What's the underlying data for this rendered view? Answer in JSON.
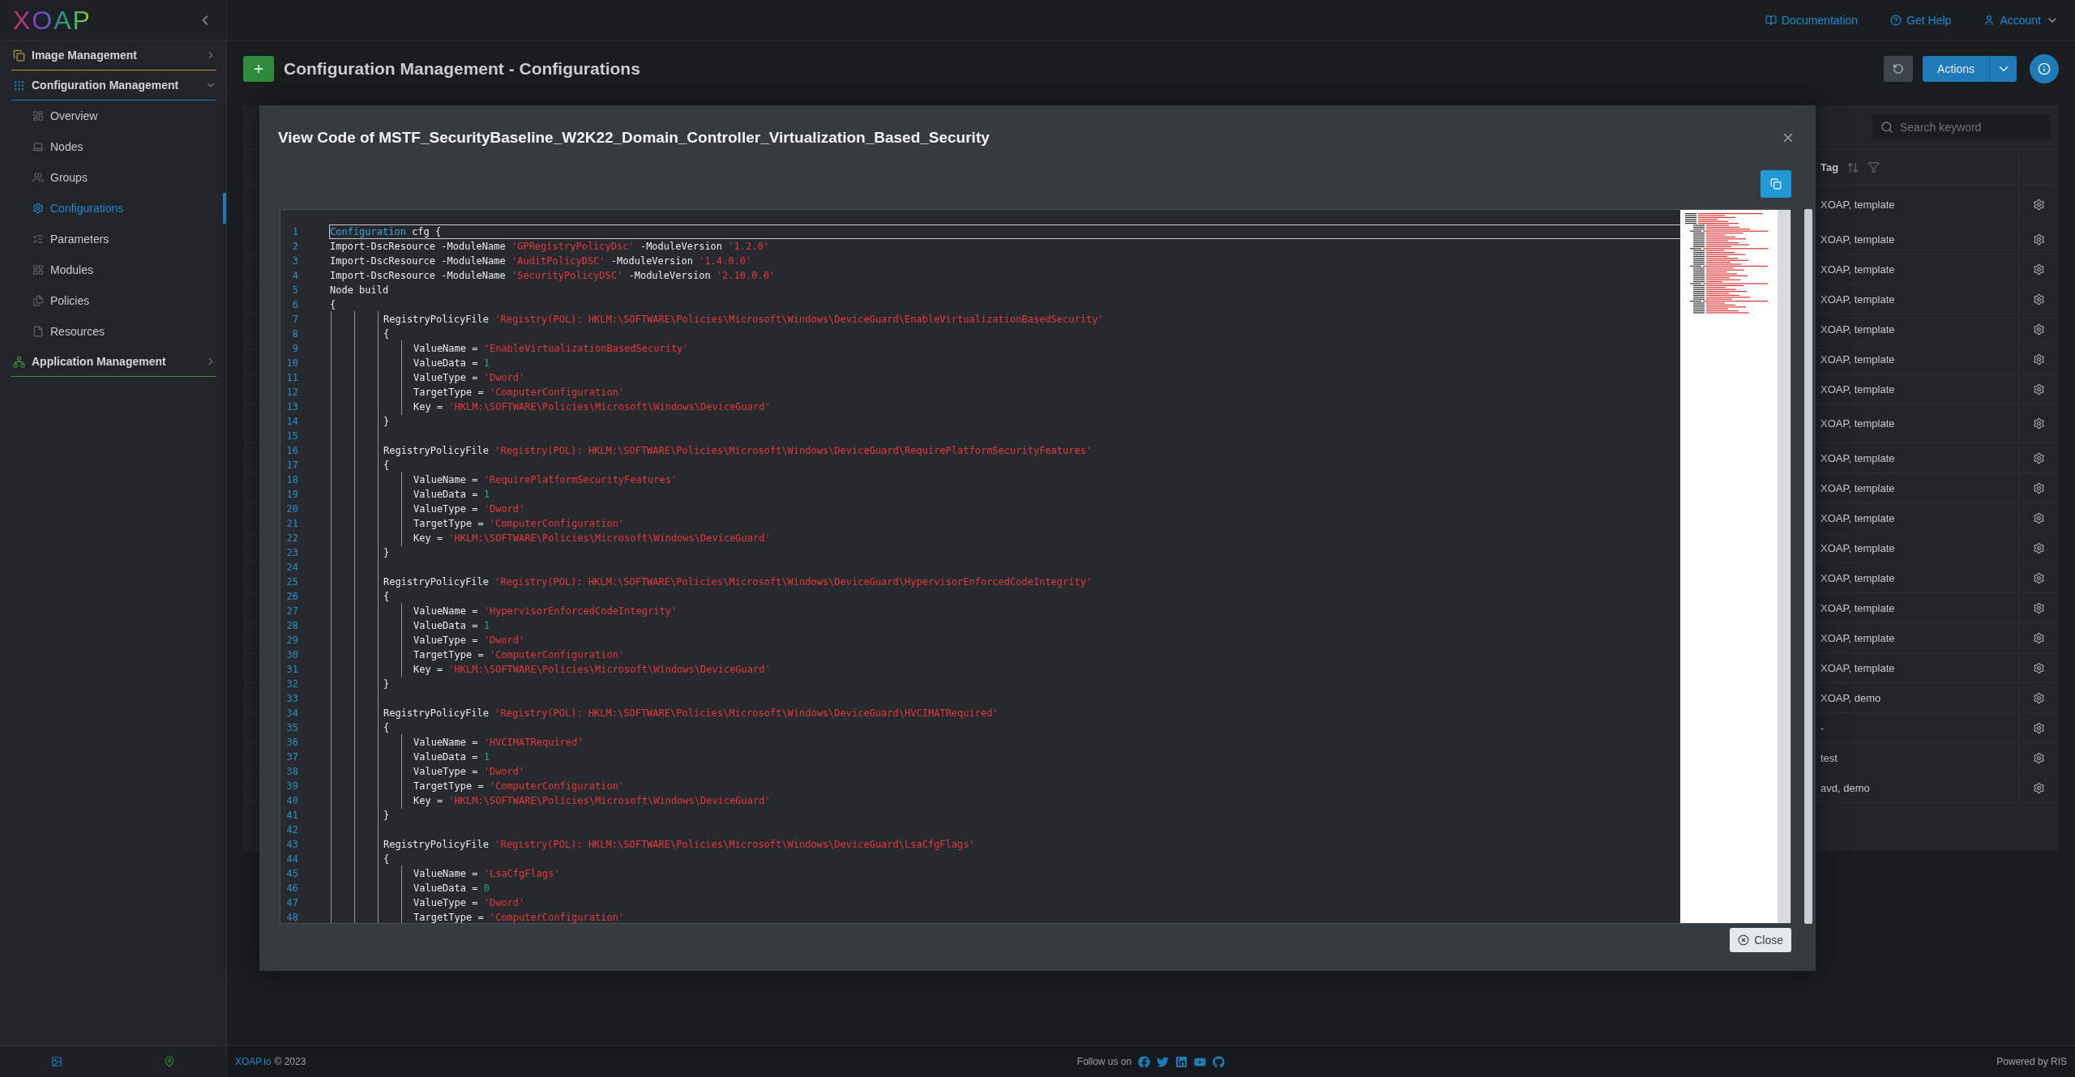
{
  "sidebar": {
    "logo": "XOAP",
    "groups": [
      {
        "label": "Image Management",
        "expanded": false,
        "color": "#b8962e"
      },
      {
        "label": "Configuration Management",
        "expanded": true,
        "color": "#1f7ab8",
        "items": [
          {
            "label": "Overview",
            "selected": false
          },
          {
            "label": "Nodes",
            "selected": false
          },
          {
            "label": "Groups",
            "selected": false
          },
          {
            "label": "Configurations",
            "selected": true
          },
          {
            "label": "Parameters",
            "selected": false
          },
          {
            "label": "Modules",
            "selected": false
          },
          {
            "label": "Policies",
            "selected": false
          },
          {
            "label": "Resources",
            "selected": false
          }
        ]
      },
      {
        "label": "Application Management",
        "expanded": false,
        "color": "#3d8f3a"
      }
    ]
  },
  "top_bar": {
    "links": [
      "Documentation",
      "Get Help",
      "Account"
    ]
  },
  "header": {
    "title": "Configuration Management - Configurations",
    "actions_label": "Actions"
  },
  "table": {
    "search": {
      "placeholder": "Search keyword"
    },
    "column": "Tag",
    "rows": [
      {
        "tag": "XOAP, template"
      },
      {
        "tag": "XOAP, template"
      },
      {
        "tag": "XOAP, template"
      },
      {
        "tag": "XOAP, template"
      },
      {
        "tag": "XOAP, template"
      },
      {
        "tag": "XOAP, template"
      },
      {
        "tag": "XOAP, template"
      },
      {
        "tag": "XOAP, template"
      },
      {
        "tag": "XOAP, template"
      },
      {
        "tag": "XOAP, template"
      },
      {
        "tag": "XOAP, template"
      },
      {
        "tag": "XOAP, template"
      },
      {
        "tag": "XOAP, template"
      },
      {
        "tag": "XOAP, template"
      },
      {
        "tag": "XOAP, template"
      },
      {
        "tag": "XOAP, template"
      },
      {
        "tag": "XOAP, demo"
      },
      {
        "tag": "-"
      },
      {
        "tag": "test"
      },
      {
        "tag": "avd, demo"
      }
    ]
  },
  "modal": {
    "title": "View Code of MSTF_SecurityBaseline_W2K22_Domain_Controller_Virtualization_Based_Security",
    "close_label": "Close",
    "lines": [
      {
        "number": "1",
        "active": true,
        "tokens": [
          {
            "kind": "keyword",
            "text": "Configuration"
          },
          {
            "kind": "plain",
            "text": " cfg {"
          }
        ]
      },
      {
        "number": "2",
        "tokens": [
          {
            "kind": "plain",
            "text": "Import-DscResource -ModuleName "
          },
          {
            "kind": "string",
            "text": "'GPRegistryPolicyDsc'"
          },
          {
            "kind": "plain",
            "text": " -ModuleVersion "
          },
          {
            "kind": "string",
            "text": "'1.2.0'"
          }
        ]
      },
      {
        "number": "3",
        "tokens": [
          {
            "kind": "plain",
            "text": "Import-DscResource -ModuleName "
          },
          {
            "kind": "string",
            "text": "'AuditPolicyDSC'"
          },
          {
            "kind": "plain",
            "text": " -ModuleVersion "
          },
          {
            "kind": "string",
            "text": "'1.4.0.0'"
          }
        ]
      },
      {
        "number": "4",
        "tokens": [
          {
            "kind": "plain",
            "text": "Import-DscResource -ModuleName "
          },
          {
            "kind": "string",
            "text": "'SecurityPolicyDSC'"
          },
          {
            "kind": "plain",
            "text": " -ModuleVersion "
          },
          {
            "kind": "string",
            "text": "'2.10.0.0'"
          }
        ]
      },
      {
        "number": "5",
        "tokens": [
          {
            "kind": "plain",
            "text": "Node build"
          }
        ]
      },
      {
        "number": "6",
        "tokens": [
          {
            "kind": "plain",
            "text": "{"
          }
        ]
      },
      {
        "number": "7",
        "tokens": [
          {
            "kind": "plain",
            "text": "            RegistryPolicyFile "
          },
          {
            "kind": "string",
            "text": "'Registry(POL): HKLM:\\SOFTWARE\\Policies\\Microsoft\\Windows\\DeviceGuard\\EnableVirtualizationBasedSecurity'"
          }
        ]
      },
      {
        "number": "8",
        "tokens": [
          {
            "kind": "plain",
            "text": "            {"
          }
        ]
      },
      {
        "number": "9",
        "tokens": [
          {
            "kind": "plain",
            "text": "                ValueName = "
          },
          {
            "kind": "string",
            "text": "'EnableVirtualizationBasedSecurity'"
          }
        ]
      },
      {
        "number": "10",
        "tokens": [
          {
            "kind": "plain",
            "text": "                ValueData = "
          },
          {
            "kind": "number",
            "text": "1"
          }
        ]
      },
      {
        "number": "11",
        "tokens": [
          {
            "kind": "plain",
            "text": "                ValueType = "
          },
          {
            "kind": "string",
            "text": "'Dword'"
          }
        ]
      },
      {
        "number": "12",
        "tokens": [
          {
            "kind": "plain",
            "text": "                TargetType = "
          },
          {
            "kind": "string",
            "text": "'ComputerConfiguration'"
          }
        ]
      },
      {
        "number": "13",
        "tokens": [
          {
            "kind": "plain",
            "text": "                Key = "
          },
          {
            "kind": "string",
            "text": "'HKLM:\\SOFTWARE\\Policies\\Microsoft\\Windows\\DeviceGuard'"
          }
        ]
      },
      {
        "number": "14",
        "tokens": [
          {
            "kind": "plain",
            "text": "            }"
          }
        ]
      },
      {
        "number": "15"
      },
      {
        "number": "16",
        "tokens": [
          {
            "kind": "plain",
            "text": "            RegistryPolicyFile "
          },
          {
            "kind": "string",
            "text": "'Registry(POL): HKLM:\\SOFTWARE\\Policies\\Microsoft\\Windows\\DeviceGuard\\RequirePlatformSecurityFeatures'"
          }
        ]
      },
      {
        "number": "17",
        "tokens": [
          {
            "kind": "plain",
            "text": "            {"
          }
        ]
      },
      {
        "number": "18",
        "tokens": [
          {
            "kind": "plain",
            "text": "                ValueName = "
          },
          {
            "kind": "string",
            "text": "'RequirePlatformSecurityFeatures'"
          }
        ]
      },
      {
        "number": "19",
        "tokens": [
          {
            "kind": "plain",
            "text": "                ValueData = "
          },
          {
            "kind": "number",
            "text": "1"
          }
        ]
      },
      {
        "number": "20",
        "tokens": [
          {
            "kind": "plain",
            "text": "                ValueType = "
          },
          {
            "kind": "string",
            "text": "'Dword'"
          }
        ]
      },
      {
        "number": "21",
        "tokens": [
          {
            "kind": "plain",
            "text": "                TargetType = "
          },
          {
            "kind": "string",
            "text": "'ComputerConfiguration'"
          }
        ]
      },
      {
        "number": "22",
        "tokens": [
          {
            "kind": "plain",
            "text": "                Key = "
          },
          {
            "kind": "string",
            "text": "'HKLM:\\SOFTWARE\\Policies\\Microsoft\\Windows\\DeviceGuard'"
          }
        ]
      },
      {
        "number": "23",
        "tokens": [
          {
            "kind": "plain",
            "text": "            }"
          }
        ]
      },
      {
        "number": "24"
      },
      {
        "number": "25",
        "tokens": [
          {
            "kind": "plain",
            "text": "            RegistryPolicyFile "
          },
          {
            "kind": "string",
            "text": "'Registry(POL): HKLM:\\SOFTWARE\\Policies\\Microsoft\\Windows\\DeviceGuard\\HypervisorEnforcedCodeIntegrity'"
          }
        ]
      },
      {
        "number": "26",
        "tokens": [
          {
            "kind": "plain",
            "text": "            {"
          }
        ]
      },
      {
        "number": "27",
        "tokens": [
          {
            "kind": "plain",
            "text": "                ValueName = "
          },
          {
            "kind": "string",
            "text": "'HypervisorEnforcedCodeIntegrity'"
          }
        ]
      },
      {
        "number": "28",
        "tokens": [
          {
            "kind": "plain",
            "text": "                ValueData = "
          },
          {
            "kind": "number",
            "text": "1"
          }
        ]
      },
      {
        "number": "29",
        "tokens": [
          {
            "kind": "plain",
            "text": "                ValueType = "
          },
          {
            "kind": "string",
            "text": "'Dword'"
          }
        ]
      },
      {
        "number": "30",
        "tokens": [
          {
            "kind": "plain",
            "text": "                TargetType = "
          },
          {
            "kind": "string",
            "text": "'ComputerConfiguration'"
          }
        ]
      },
      {
        "number": "31",
        "tokens": [
          {
            "kind": "plain",
            "text": "                Key = "
          },
          {
            "kind": "string",
            "text": "'HKLM:\\SOFTWARE\\Policies\\Microsoft\\Windows\\DeviceGuard'"
          }
        ]
      },
      {
        "number": "32",
        "tokens": [
          {
            "kind": "plain",
            "text": "            }"
          }
        ]
      },
      {
        "number": "33"
      },
      {
        "number": "34",
        "tokens": [
          {
            "kind": "plain",
            "text": "            RegistryPolicyFile "
          },
          {
            "kind": "string",
            "text": "'Registry(POL): HKLM:\\SOFTWARE\\Policies\\Microsoft\\Windows\\DeviceGuard\\HVCIMATRequired'"
          }
        ]
      },
      {
        "number": "35",
        "tokens": [
          {
            "kind": "plain",
            "text": "            {"
          }
        ]
      },
      {
        "number": "36",
        "tokens": [
          {
            "kind": "plain",
            "text": "                ValueName = "
          },
          {
            "kind": "string",
            "text": "'HVCIMATRequired'"
          }
        ]
      },
      {
        "number": "37",
        "tokens": [
          {
            "kind": "plain",
            "text": "                ValueData = "
          },
          {
            "kind": "number",
            "text": "1"
          }
        ]
      },
      {
        "number": "38",
        "tokens": [
          {
            "kind": "plain",
            "text": "                ValueType = "
          },
          {
            "kind": "string",
            "text": "'Dword'"
          }
        ]
      },
      {
        "number": "39",
        "tokens": [
          {
            "kind": "plain",
            "text": "                TargetType = "
          },
          {
            "kind": "string",
            "text": "'ComputerConfiguration'"
          }
        ]
      },
      {
        "number": "40",
        "tokens": [
          {
            "kind": "plain",
            "text": "                Key = "
          },
          {
            "kind": "string",
            "text": "'HKLM:\\SOFTWARE\\Policies\\Microsoft\\Windows\\DeviceGuard'"
          }
        ]
      },
      {
        "number": "41",
        "tokens": [
          {
            "kind": "plain",
            "text": "            }"
          }
        ]
      },
      {
        "number": "42"
      },
      {
        "number": "43",
        "tokens": [
          {
            "kind": "plain",
            "text": "            RegistryPolicyFile "
          },
          {
            "kind": "string",
            "text": "'Registry(POL): HKLM:\\SOFTWARE\\Policies\\Microsoft\\Windows\\DeviceGuard\\LsaCfgFlags'"
          }
        ]
      },
      {
        "number": "44",
        "tokens": [
          {
            "kind": "plain",
            "text": "            {"
          }
        ]
      },
      {
        "number": "45",
        "tokens": [
          {
            "kind": "plain",
            "text": "                ValueName = "
          },
          {
            "kind": "string",
            "text": "'LsaCfgFlags'"
          }
        ]
      },
      {
        "number": "46",
        "tokens": [
          {
            "kind": "plain",
            "text": "                ValueData = "
          },
          {
            "kind": "number",
            "text": "0"
          }
        ]
      },
      {
        "number": "47",
        "tokens": [
          {
            "kind": "plain",
            "text": "                ValueType = "
          },
          {
            "kind": "string",
            "text": "'Dword'"
          }
        ]
      },
      {
        "number": "48",
        "tokens": [
          {
            "kind": "plain",
            "text": "                TargetType = "
          },
          {
            "kind": "string",
            "text": "'ComputerConfiguration'"
          }
        ]
      }
    ]
  },
  "footer": {
    "site_link": "XOAP.io",
    "copyright": "© 2023",
    "follow_label": "Follow us on",
    "powered_by": "Powered by RIS"
  }
}
